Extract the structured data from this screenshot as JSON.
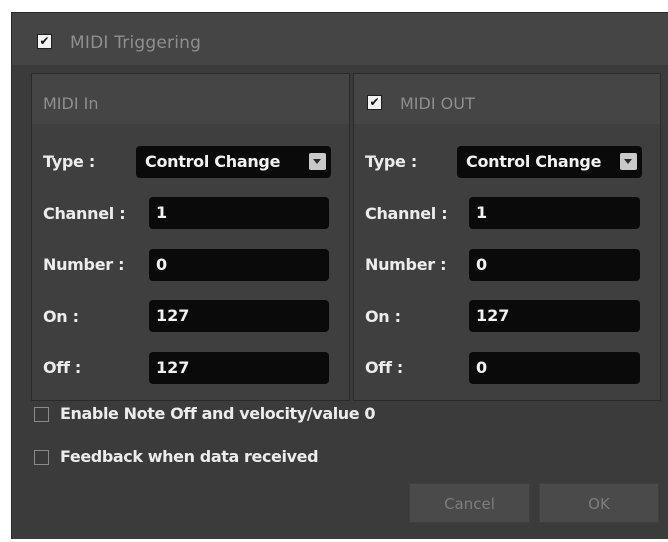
{
  "window": {
    "title_checkbox_checked": true,
    "title": "MIDI Triggering"
  },
  "midi_in": {
    "title": "MIDI In",
    "type_label": "Type :",
    "type_value": "Control Change",
    "channel_label": "Channel :",
    "channel_value": "1",
    "number_label": "Number :",
    "number_value": "0",
    "on_label": "On :",
    "on_value": "127",
    "off_label": "Off :",
    "off_value": "127"
  },
  "midi_out": {
    "checkbox_checked": true,
    "title": "MIDI OUT",
    "type_label": "Type :",
    "type_value": "Control Change",
    "channel_label": "Channel :",
    "channel_value": "1",
    "number_label": "Number :",
    "number_value": "0",
    "on_label": "On :",
    "on_value": "127",
    "off_label": "Off :",
    "off_value": "0"
  },
  "options": {
    "enable_note_off_label": "Enable Note Off and velocity/value 0",
    "enable_note_off_checked": false,
    "feedback_label": "Feedback when data received",
    "feedback_checked": false
  },
  "buttons": {
    "cancel_label": "Cancel",
    "ok_label": "OK"
  },
  "check_glyph": "✔"
}
